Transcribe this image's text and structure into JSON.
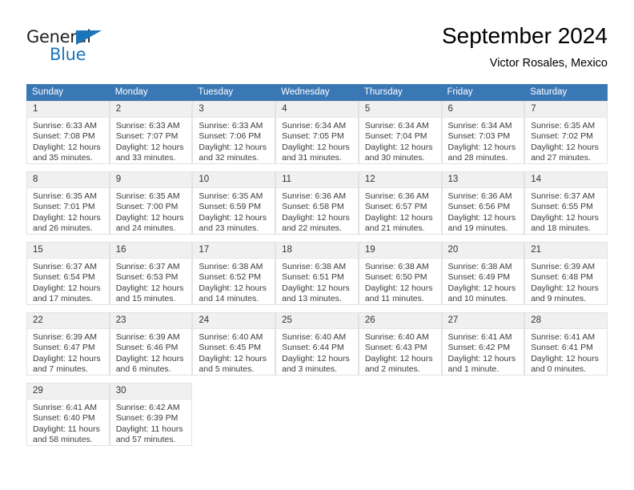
{
  "brand": {
    "name_part1": "General",
    "name_part2": "Blue",
    "accent_color": "#1b75bb"
  },
  "header": {
    "title": "September 2024",
    "subtitle": "Victor Rosales, Mexico"
  },
  "calendar": {
    "header_color": "#3a77b5",
    "daynum_background": "#f0f0f0",
    "weekdays": [
      "Sunday",
      "Monday",
      "Tuesday",
      "Wednesday",
      "Thursday",
      "Friday",
      "Saturday"
    ],
    "labels": {
      "sunrise": "Sunrise:",
      "sunset": "Sunset:",
      "daylight": "Daylight:"
    },
    "weeks": [
      {
        "days": [
          {
            "day": "1",
            "sunrise": "Sunrise: 6:33 AM",
            "sunset": "Sunset: 7:08 PM",
            "daylight": "Daylight: 12 hours and 35 minutes."
          },
          {
            "day": "2",
            "sunrise": "Sunrise: 6:33 AM",
            "sunset": "Sunset: 7:07 PM",
            "daylight": "Daylight: 12 hours and 33 minutes."
          },
          {
            "day": "3",
            "sunrise": "Sunrise: 6:33 AM",
            "sunset": "Sunset: 7:06 PM",
            "daylight": "Daylight: 12 hours and 32 minutes."
          },
          {
            "day": "4",
            "sunrise": "Sunrise: 6:34 AM",
            "sunset": "Sunset: 7:05 PM",
            "daylight": "Daylight: 12 hours and 31 minutes."
          },
          {
            "day": "5",
            "sunrise": "Sunrise: 6:34 AM",
            "sunset": "Sunset: 7:04 PM",
            "daylight": "Daylight: 12 hours and 30 minutes."
          },
          {
            "day": "6",
            "sunrise": "Sunrise: 6:34 AM",
            "sunset": "Sunset: 7:03 PM",
            "daylight": "Daylight: 12 hours and 28 minutes."
          },
          {
            "day": "7",
            "sunrise": "Sunrise: 6:35 AM",
            "sunset": "Sunset: 7:02 PM",
            "daylight": "Daylight: 12 hours and 27 minutes."
          }
        ]
      },
      {
        "days": [
          {
            "day": "8",
            "sunrise": "Sunrise: 6:35 AM",
            "sunset": "Sunset: 7:01 PM",
            "daylight": "Daylight: 12 hours and 26 minutes."
          },
          {
            "day": "9",
            "sunrise": "Sunrise: 6:35 AM",
            "sunset": "Sunset: 7:00 PM",
            "daylight": "Daylight: 12 hours and 24 minutes."
          },
          {
            "day": "10",
            "sunrise": "Sunrise: 6:35 AM",
            "sunset": "Sunset: 6:59 PM",
            "daylight": "Daylight: 12 hours and 23 minutes."
          },
          {
            "day": "11",
            "sunrise": "Sunrise: 6:36 AM",
            "sunset": "Sunset: 6:58 PM",
            "daylight": "Daylight: 12 hours and 22 minutes."
          },
          {
            "day": "12",
            "sunrise": "Sunrise: 6:36 AM",
            "sunset": "Sunset: 6:57 PM",
            "daylight": "Daylight: 12 hours and 21 minutes."
          },
          {
            "day": "13",
            "sunrise": "Sunrise: 6:36 AM",
            "sunset": "Sunset: 6:56 PM",
            "daylight": "Daylight: 12 hours and 19 minutes."
          },
          {
            "day": "14",
            "sunrise": "Sunrise: 6:37 AM",
            "sunset": "Sunset: 6:55 PM",
            "daylight": "Daylight: 12 hours and 18 minutes."
          }
        ]
      },
      {
        "days": [
          {
            "day": "15",
            "sunrise": "Sunrise: 6:37 AM",
            "sunset": "Sunset: 6:54 PM",
            "daylight": "Daylight: 12 hours and 17 minutes."
          },
          {
            "day": "16",
            "sunrise": "Sunrise: 6:37 AM",
            "sunset": "Sunset: 6:53 PM",
            "daylight": "Daylight: 12 hours and 15 minutes."
          },
          {
            "day": "17",
            "sunrise": "Sunrise: 6:38 AM",
            "sunset": "Sunset: 6:52 PM",
            "daylight": "Daylight: 12 hours and 14 minutes."
          },
          {
            "day": "18",
            "sunrise": "Sunrise: 6:38 AM",
            "sunset": "Sunset: 6:51 PM",
            "daylight": "Daylight: 12 hours and 13 minutes."
          },
          {
            "day": "19",
            "sunrise": "Sunrise: 6:38 AM",
            "sunset": "Sunset: 6:50 PM",
            "daylight": "Daylight: 12 hours and 11 minutes."
          },
          {
            "day": "20",
            "sunrise": "Sunrise: 6:38 AM",
            "sunset": "Sunset: 6:49 PM",
            "daylight": "Daylight: 12 hours and 10 minutes."
          },
          {
            "day": "21",
            "sunrise": "Sunrise: 6:39 AM",
            "sunset": "Sunset: 6:48 PM",
            "daylight": "Daylight: 12 hours and 9 minutes."
          }
        ]
      },
      {
        "days": [
          {
            "day": "22",
            "sunrise": "Sunrise: 6:39 AM",
            "sunset": "Sunset: 6:47 PM",
            "daylight": "Daylight: 12 hours and 7 minutes."
          },
          {
            "day": "23",
            "sunrise": "Sunrise: 6:39 AM",
            "sunset": "Sunset: 6:46 PM",
            "daylight": "Daylight: 12 hours and 6 minutes."
          },
          {
            "day": "24",
            "sunrise": "Sunrise: 6:40 AM",
            "sunset": "Sunset: 6:45 PM",
            "daylight": "Daylight: 12 hours and 5 minutes."
          },
          {
            "day": "25",
            "sunrise": "Sunrise: 6:40 AM",
            "sunset": "Sunset: 6:44 PM",
            "daylight": "Daylight: 12 hours and 3 minutes."
          },
          {
            "day": "26",
            "sunrise": "Sunrise: 6:40 AM",
            "sunset": "Sunset: 6:43 PM",
            "daylight": "Daylight: 12 hours and 2 minutes."
          },
          {
            "day": "27",
            "sunrise": "Sunrise: 6:41 AM",
            "sunset": "Sunset: 6:42 PM",
            "daylight": "Daylight: 12 hours and 1 minute."
          },
          {
            "day": "28",
            "sunrise": "Sunrise: 6:41 AM",
            "sunset": "Sunset: 6:41 PM",
            "daylight": "Daylight: 12 hours and 0 minutes."
          }
        ]
      },
      {
        "days": [
          {
            "day": "29",
            "sunrise": "Sunrise: 6:41 AM",
            "sunset": "Sunset: 6:40 PM",
            "daylight": "Daylight: 11 hours and 58 minutes."
          },
          {
            "day": "30",
            "sunrise": "Sunrise: 6:42 AM",
            "sunset": "Sunset: 6:39 PM",
            "daylight": "Daylight: 11 hours and 57 minutes."
          },
          {
            "day": "",
            "sunrise": "",
            "sunset": "",
            "daylight": ""
          },
          {
            "day": "",
            "sunrise": "",
            "sunset": "",
            "daylight": ""
          },
          {
            "day": "",
            "sunrise": "",
            "sunset": "",
            "daylight": ""
          },
          {
            "day": "",
            "sunrise": "",
            "sunset": "",
            "daylight": ""
          },
          {
            "day": "",
            "sunrise": "",
            "sunset": "",
            "daylight": ""
          }
        ]
      }
    ]
  }
}
